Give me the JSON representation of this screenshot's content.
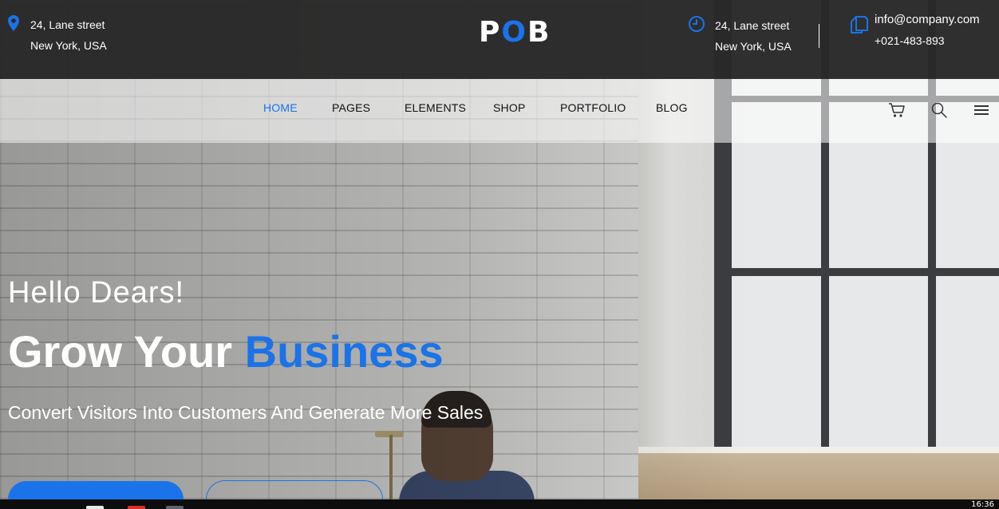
{
  "top_bar": {
    "address_left": {
      "icon": "map-pin-icon",
      "line1": "24, Lane street",
      "line2": "New York, USA"
    },
    "logo": {
      "part1": "P",
      "part2": "O",
      "part3": "B"
    },
    "address_right": {
      "icon": "clock-icon",
      "line1": "24, Lane street",
      "line2": "New York, USA"
    },
    "contact": {
      "icon": "copy-icon",
      "email": "info@company.com",
      "phone": "+021-483-893"
    }
  },
  "nav": {
    "items": [
      {
        "label": "HOME",
        "active": true
      },
      {
        "label": "PAGES",
        "active": false
      },
      {
        "label": "ELEMENTS",
        "active": false
      },
      {
        "label": "SHOP",
        "active": false
      },
      {
        "label": "PORTFOLIO",
        "active": false
      },
      {
        "label": "BLOG",
        "active": false
      }
    ],
    "icons": [
      "cart-icon",
      "search-icon",
      "menu-icon"
    ]
  },
  "hero": {
    "greeting": "Hello Dears!",
    "title_white": "Grow Your ",
    "title_blue": "Business",
    "subtitle": "Convert Visitors Into Customers And Generate More Sales"
  },
  "taskbar": {
    "clock": "16:36"
  },
  "colors": {
    "accent": "#1a73e8",
    "top_bar_bg": "#282828",
    "text_light": "#ffffff"
  }
}
